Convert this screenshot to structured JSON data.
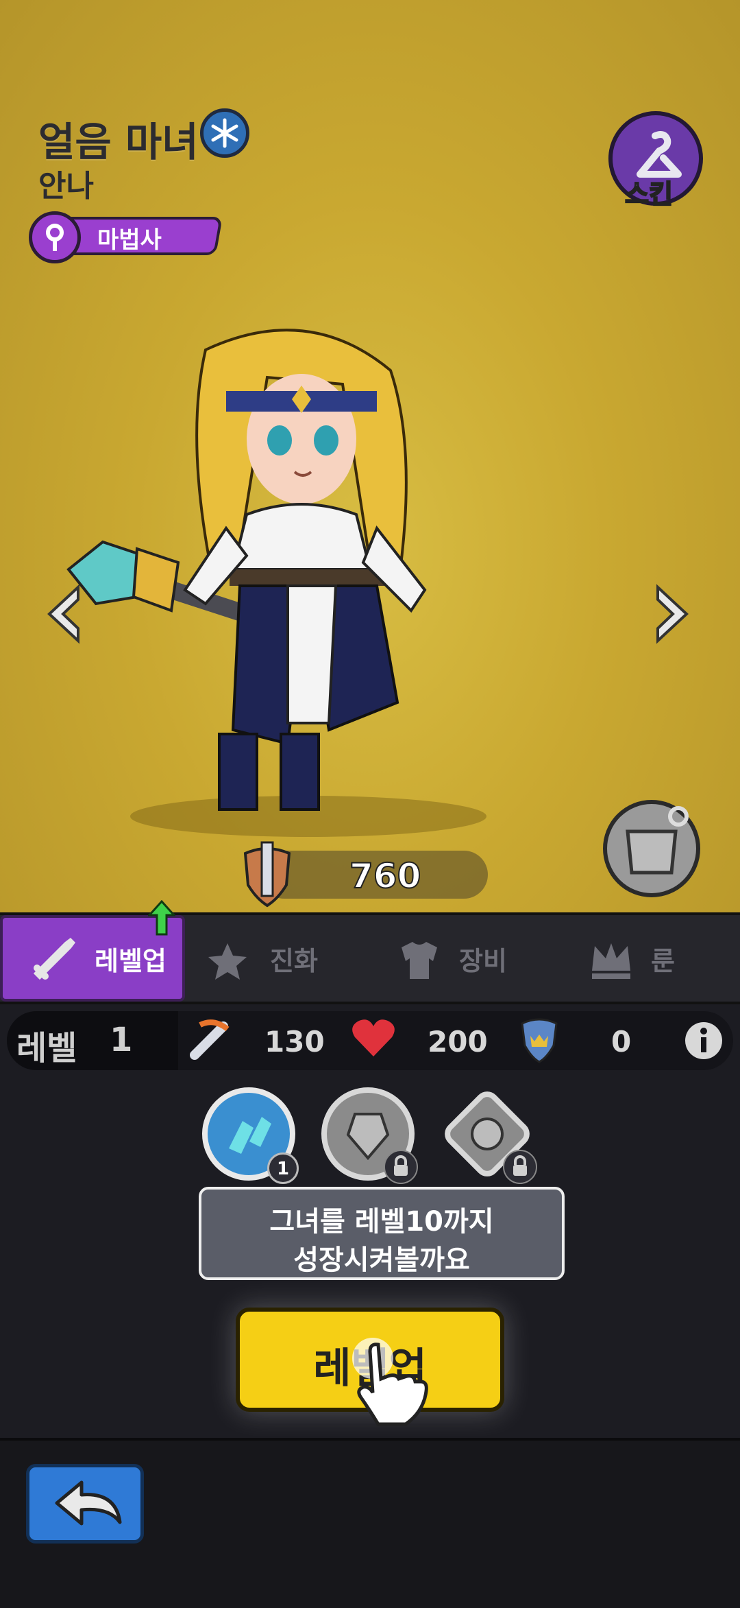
{
  "hero": {
    "name": "얼음 마녀",
    "subtitle": "안나",
    "class_label": "마법사",
    "skin_label": "스킨",
    "power": "760"
  },
  "tabs": [
    {
      "label": "레벨업",
      "active": true
    },
    {
      "label": "진화",
      "active": false
    },
    {
      "label": "장비",
      "active": false
    },
    {
      "label": "룬",
      "active": false
    }
  ],
  "stats": {
    "level_label": "레벨",
    "level_value": "1",
    "attack": "130",
    "health": "200",
    "defense": "0"
  },
  "skills": [
    {
      "name": "ice-skill",
      "badge": "1",
      "locked": false
    },
    {
      "name": "armor-skill",
      "badge": "",
      "locked": true
    },
    {
      "name": "gear-skill",
      "badge": "",
      "locked": true
    }
  ],
  "hint": {
    "line1": "그녀를 레벨10까지",
    "line2": "성장시켜볼까요"
  },
  "levelup_button": "레벨업",
  "colors": {
    "background": "#c9a831",
    "active_tab": "#8a3ec6",
    "button": "#f5cf15",
    "back_button": "#2f7ad6"
  }
}
